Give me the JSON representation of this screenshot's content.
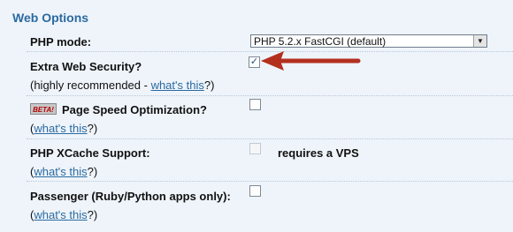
{
  "section": {
    "title": "Web Options"
  },
  "options": {
    "php_mode": {
      "label": "PHP mode:",
      "selected": "PHP 5.2.x FastCGI (default)"
    },
    "extra_security": {
      "label": "Extra Web Security?",
      "sub_prefix": "(highly recommended - ",
      "link": "what's this",
      "sub_suffix": "?)",
      "checked": true
    },
    "page_speed": {
      "badge": "BETA!",
      "label": "Page Speed Optimization?",
      "sub_prefix": "(",
      "link": "what's this",
      "sub_suffix": "?)",
      "checked": false
    },
    "xcache": {
      "label": "PHP XCache Support:",
      "note": "requires a VPS",
      "sub_prefix": "(",
      "link": "what's this",
      "sub_suffix": "?)",
      "checked": false,
      "disabled": true
    },
    "passenger": {
      "label": "Passenger (Ruby/Python apps only):",
      "sub_prefix": "(",
      "link": "what's this",
      "sub_suffix": "?)",
      "checked": false
    }
  },
  "colors": {
    "background": "#eef4fa",
    "title": "#2b6aa0",
    "link": "#2b6aa0",
    "annotation_arrow": "#b3301f"
  },
  "icons": {
    "checkbox_checked": "✓",
    "select_arrow": "▼"
  }
}
